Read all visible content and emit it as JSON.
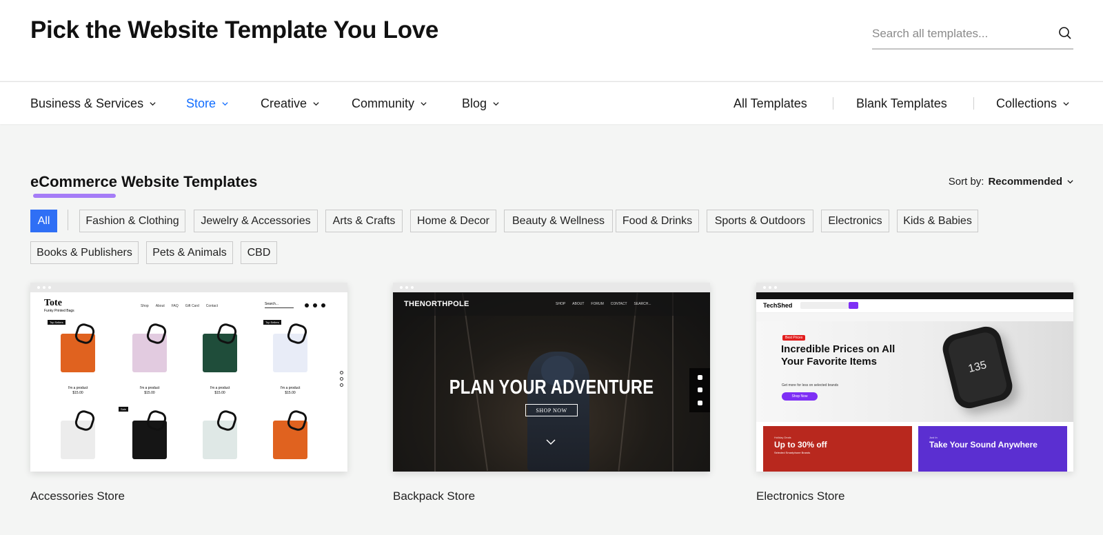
{
  "header": {
    "title": "Pick the Website Template You Love",
    "search_placeholder": "Search all templates..."
  },
  "nav": {
    "left_items": [
      {
        "label": "Business & Services",
        "active": false
      },
      {
        "label": "Store",
        "active": true
      },
      {
        "label": "Creative",
        "active": false
      },
      {
        "label": "Community",
        "active": false
      },
      {
        "label": "Blog",
        "active": false
      }
    ],
    "right_items": [
      {
        "label": "All Templates"
      },
      {
        "label": "Blank Templates"
      },
      {
        "label": "Collections"
      }
    ]
  },
  "section": {
    "title": "eCommerce Website Templates",
    "sort_label": "Sort by:",
    "sort_value": "Recommended"
  },
  "filters": {
    "active": "All",
    "chips": [
      "All",
      "Fashion & Clothing",
      "Jewelry & Accessories",
      "Arts & Crafts",
      "Home & Decor",
      "Beauty & Wellness",
      "Food & Drinks",
      "Sports & Outdoors",
      "Electronics",
      "Kids & Babies",
      "Books & Publishers",
      "Pets & Animals",
      "CBD"
    ]
  },
  "templates": [
    {
      "name": "Accessories Store",
      "preview": {
        "logo": "Tote",
        "tagline": "Funky Printed Bags",
        "links": [
          "Shop",
          "About",
          "FAQ",
          "Gift Card",
          "Contact"
        ],
        "search": "Search...",
        "product_name": "I'm a product",
        "product_price": "$15.00",
        "tag_top": "Top Sellers",
        "tag_sale": "Sale"
      }
    },
    {
      "name": "Backpack Store",
      "preview": {
        "logo": "THENORTHPOLE",
        "links": [
          "SHOP",
          "ABOUT",
          "FORUM",
          "CONTACT",
          "SEARCH..."
        ],
        "hero": "PLAN YOUR ADVENTURE",
        "button": "SHOP NOW"
      }
    },
    {
      "name": "Electronics Store",
      "preview": {
        "logo": "TechShed",
        "badge": "Best Prices",
        "headline": "Incredible Prices on All Your Favorite Items",
        "sub": "Get more for less on selected brands",
        "button": "Shop Now",
        "watch_text": "135",
        "promo1_kicker": "Holiday Deals",
        "promo1_title": "Up to 30% off",
        "promo1_sub": "Selected Smartphone Brands",
        "promo2_kicker": "Just In",
        "promo2_title": "Take Your Sound Anywhere"
      }
    }
  ],
  "colors": {
    "accent_blue": "#116dff",
    "chip_active": "#2f6ff5",
    "underline_purple": "#a57cf7",
    "page_bg": "#f4f5f4",
    "tech_purple": "#7e2ff5",
    "promo_red": "#b8281e",
    "promo_purple": "#5b2fd1"
  },
  "icons": {
    "search": "search-icon",
    "chevron": "chevron-down-icon"
  }
}
